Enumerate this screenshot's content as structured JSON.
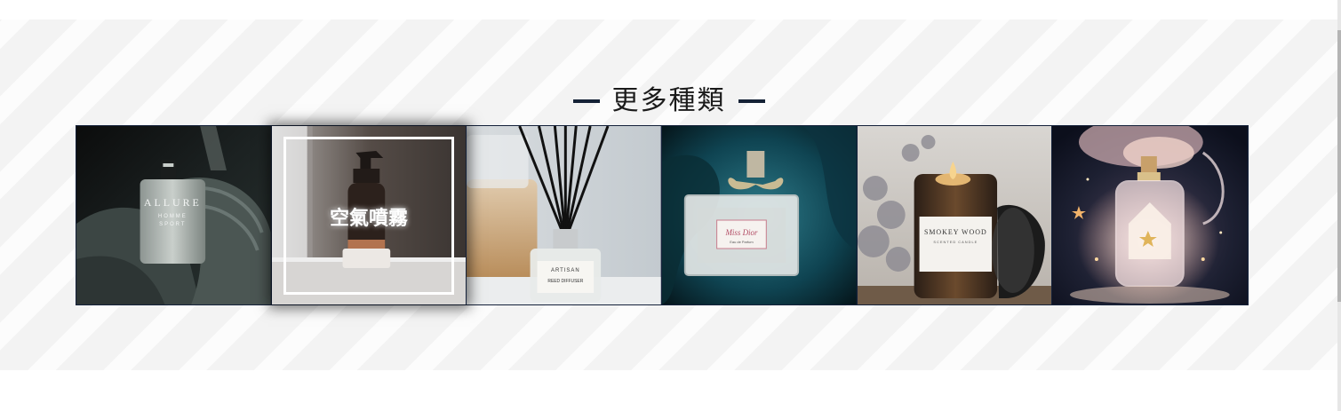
{
  "section": {
    "title": "更多種類"
  },
  "categories": [
    {
      "name": "allure-sport-cologne",
      "label": "",
      "icon": "perfume-bottle-photo"
    },
    {
      "name": "air-spray",
      "label": "空氣噴霧",
      "icon": "spray-bottle-photo",
      "active": true
    },
    {
      "name": "reed-diffuser",
      "label": "",
      "icon": "diffuser-photo"
    },
    {
      "name": "miss-dior-perfume",
      "label": "",
      "icon": "perfume-bottle-photo"
    },
    {
      "name": "scented-candle",
      "label": "",
      "icon": "candle-jar-photo"
    },
    {
      "name": "fantasy-perfume",
      "label": "",
      "icon": "perfume-bottle-photo"
    }
  ],
  "photo_text": {
    "allure": "ALLURE",
    "allure_sub1": "HOMME",
    "allure_sub2": "SPORT",
    "miss_dior": "Miss Dior",
    "miss_dior_sub": "Eau de Parfum",
    "candle": "SMOKEY WOOD",
    "candle_sub": "SCENTED CANDLE",
    "diffuser": "ARTISAN",
    "diffuser_sub": "REED DIFFUSER"
  },
  "colors": {
    "accent": "#152236",
    "frame": "#14213a",
    "background": "#f3f3f3"
  }
}
